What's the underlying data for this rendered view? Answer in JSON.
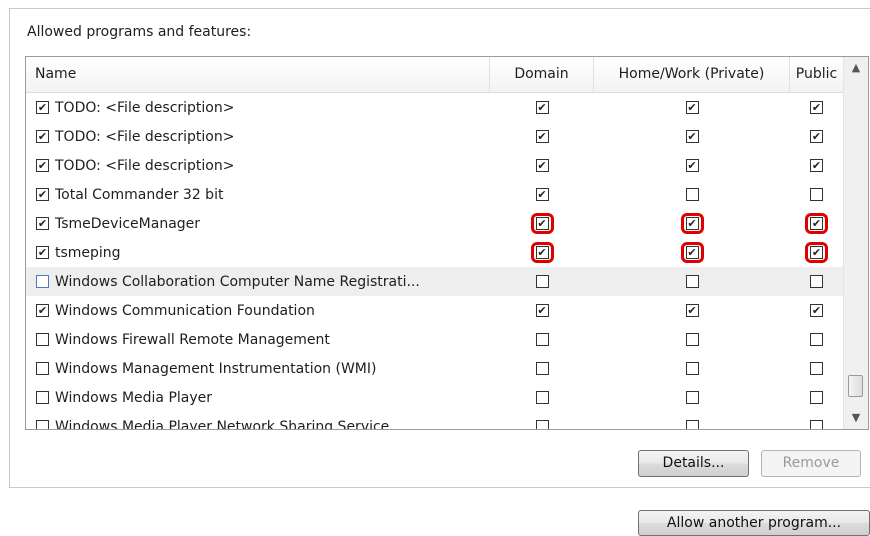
{
  "group": {
    "title": "Allowed programs and features:"
  },
  "columns": {
    "name": "Name",
    "domain": "Domain",
    "home": "Home/Work (Private)",
    "public": "Public"
  },
  "rows": [
    {
      "name": "TODO: <File description>",
      "enabled": true,
      "domain": true,
      "home": true,
      "public": true
    },
    {
      "name": "TODO: <File description>",
      "enabled": true,
      "domain": true,
      "home": true,
      "public": true
    },
    {
      "name": "TODO: <File description>",
      "enabled": true,
      "domain": true,
      "home": true,
      "public": true
    },
    {
      "name": "Total Commander 32 bit",
      "enabled": true,
      "domain": true,
      "home": false,
      "public": false
    },
    {
      "name": "TsmeDeviceManager",
      "enabled": true,
      "domain": true,
      "home": true,
      "public": true,
      "highlighted": true
    },
    {
      "name": "tsmeping",
      "enabled": true,
      "domain": true,
      "home": true,
      "public": true,
      "highlighted": true
    },
    {
      "name": "Windows Collaboration Computer Name Registrati...",
      "enabled": false,
      "domain": false,
      "home": false,
      "public": false,
      "shaded": true
    },
    {
      "name": "Windows Communication Foundation",
      "enabled": true,
      "domain": true,
      "home": true,
      "public": true
    },
    {
      "name": "Windows Firewall Remote Management",
      "enabled": false,
      "domain": false,
      "home": false,
      "public": false
    },
    {
      "name": "Windows Management Instrumentation (WMI)",
      "enabled": false,
      "domain": false,
      "home": false,
      "public": false
    },
    {
      "name": "Windows Media Player",
      "enabled": false,
      "domain": false,
      "home": false,
      "public": false
    },
    {
      "name": "Windows Media Player Network Sharing Service",
      "enabled": false,
      "domain": false,
      "home": false,
      "public": false
    }
  ],
  "buttons": {
    "details": "Details...",
    "remove": "Remove",
    "allow_another": "Allow another program..."
  },
  "colors": {
    "highlight": "#e00000",
    "shaded_row": "#eeeeee"
  }
}
